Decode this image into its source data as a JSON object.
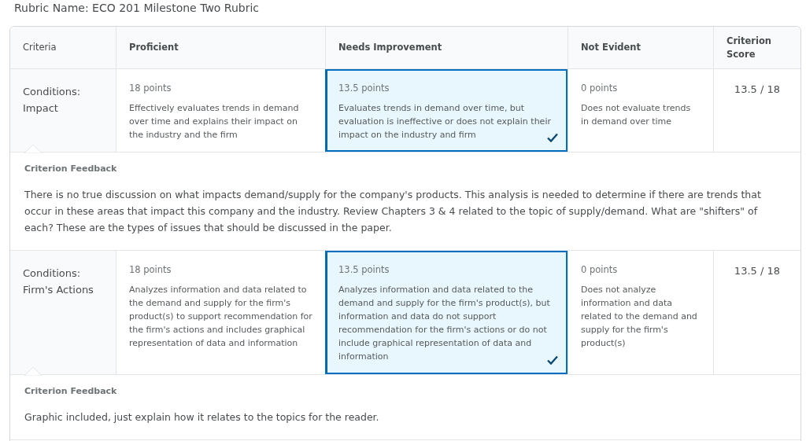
{
  "title": "Rubric Name: ECO 201 Milestone Two Rubric",
  "columns": [
    "Criteria",
    "Proficient",
    "Needs Improvement",
    "Not Evident",
    "Criterion Score"
  ],
  "criteria": [
    {
      "name": "Conditions: Impact",
      "score": "13.5 / 18",
      "levels": [
        {
          "points": "18 points",
          "description": "Effectively evaluates trends in demand over time and explains their impact on the industry and the firm",
          "selected": false
        },
        {
          "points": "13.5 points",
          "description": "Evaluates trends in demand over time, but evaluation is ineffective or does not explain their impact on the industry and firm",
          "selected": true
        },
        {
          "points": "0 points",
          "description": "Does not evaluate trends in demand over time",
          "selected": false
        }
      ],
      "feedback_label": "Criterion Feedback",
      "feedback": "There is no true discussion on what impacts demand/supply for the company's products. This analysis is needed to determine if there are trends that occur in these areas that impact this company and the industry. Review Chapters 3 & 4 related to the topic of supply/demand. What are \"shifters\" of each? These are the types of issues that should be discussed in the paper."
    },
    {
      "name": "Conditions: Firm's Actions",
      "score": "13.5 / 18",
      "levels": [
        {
          "points": "18 points",
          "description": "Analyzes information and data related to the demand and supply for the firm's product(s) to support recommendation for the firm's actions and includes graphical representation of data and information",
          "selected": false
        },
        {
          "points": "13.5 points",
          "description": "Analyzes information and data related to the demand and supply for the firm's product(s), but information and data do not support recommendation for the firm's actions or do not include graphical representation of data and information",
          "selected": true
        },
        {
          "points": "0 points",
          "description": "Does not analyze information and data related to the demand and supply for the firm's product(s)",
          "selected": false
        }
      ],
      "feedback_label": "Criterion Feedback",
      "feedback": "Graphic included, just explain how it relates to the topics for the reader."
    }
  ]
}
